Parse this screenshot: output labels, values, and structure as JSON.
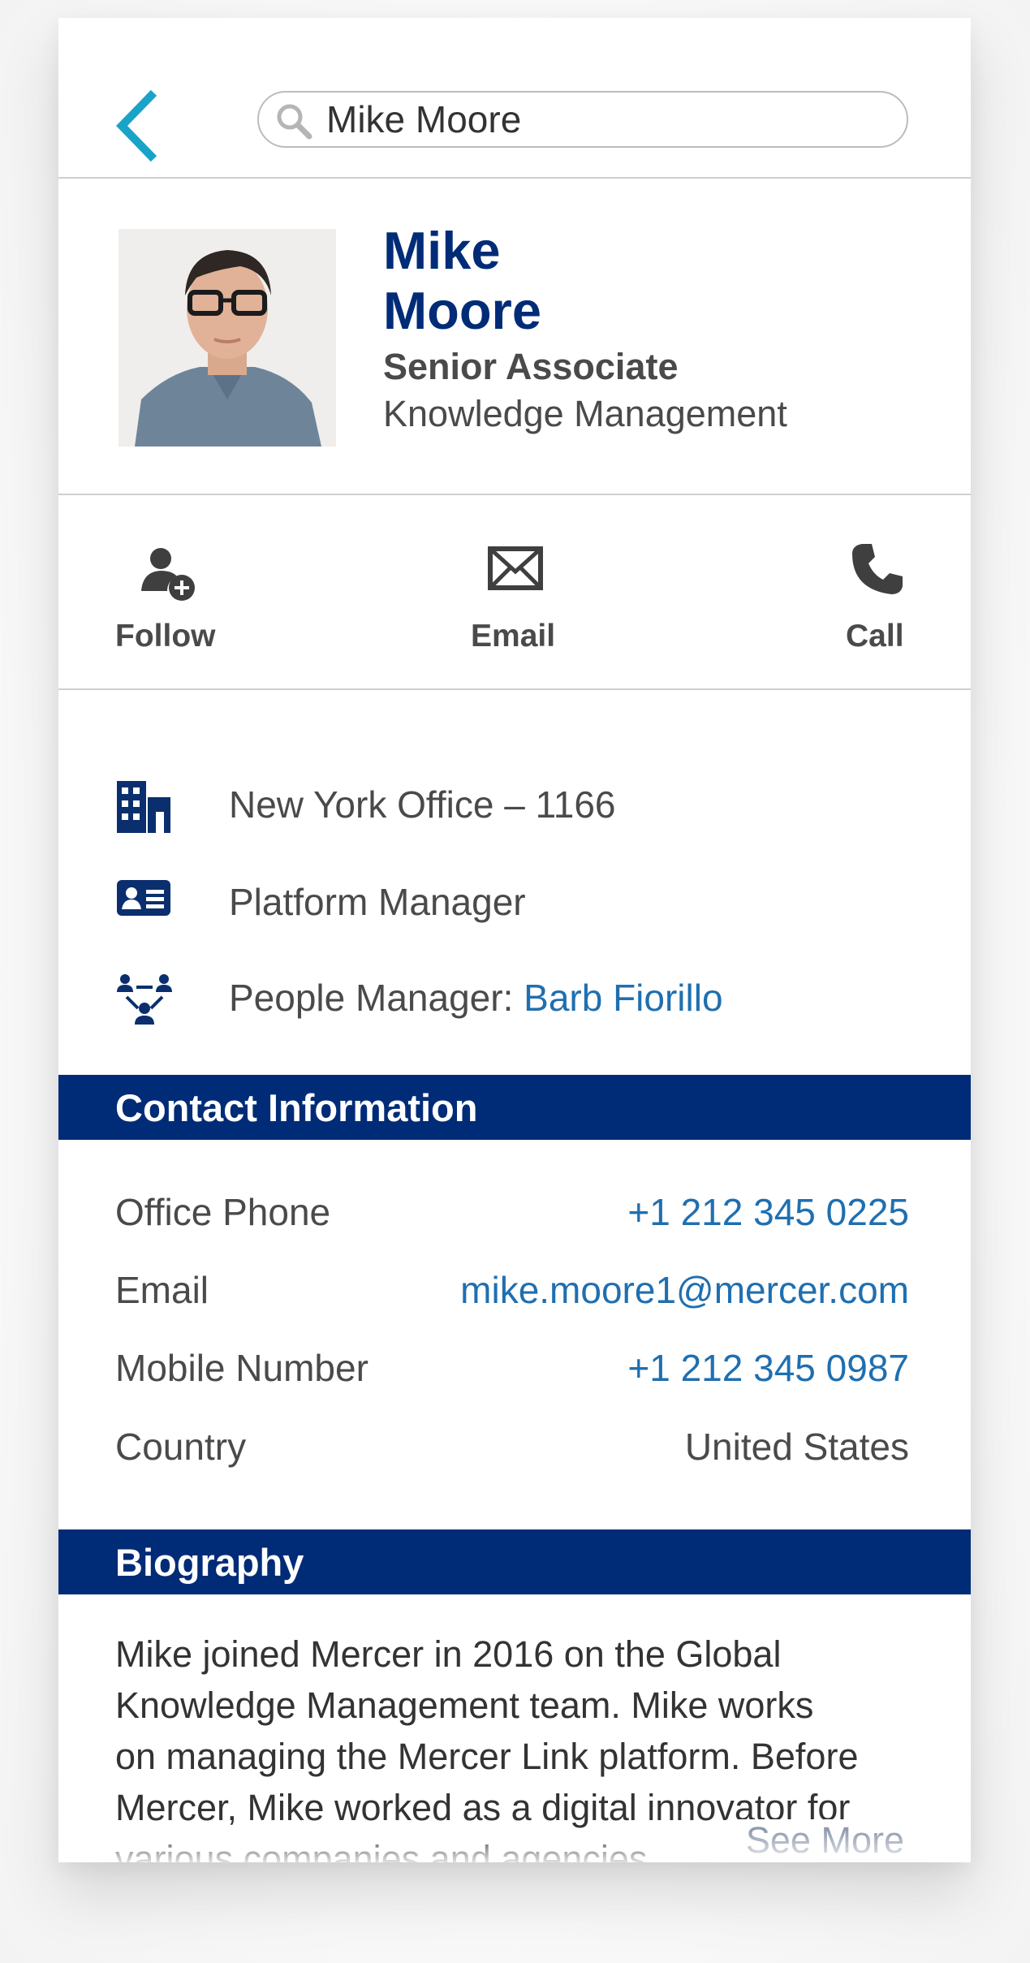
{
  "search": {
    "value": "Mike Moore"
  },
  "profile": {
    "first_name": "Mike",
    "last_name": "Moore",
    "title": "Senior Associate",
    "department": "Knowledge Management"
  },
  "actions": {
    "follow": "Follow",
    "email": "Email",
    "call": "Call"
  },
  "info": {
    "office": "New York Office – 1166",
    "role": "Platform Manager",
    "manager_label": "People Manager: ",
    "manager_name": "Barb Fiorillo"
  },
  "contact": {
    "heading": "Contact Information",
    "rows": [
      {
        "label": "Office Phone",
        "value": "+1 212 345 0225"
      },
      {
        "label": "Email",
        "value": "mike.moore1@mercer.com"
      },
      {
        "label": "Mobile Number",
        "value": "+1 212 345 0987"
      },
      {
        "label": "Country",
        "value": "United States"
      }
    ]
  },
  "biography": {
    "heading": "Biography",
    "lines": [
      "Mike joined Mercer in 2016 on the Global",
      "Knowledge Management team. Mike works",
      "on managing the Mercer Link platform. Before",
      "Mercer, Mike worked as a digital innovator for",
      "various companies and agencies."
    ],
    "see_more": "See More"
  },
  "colors": {
    "brand_navy": "#002c77",
    "link_blue": "#1f6fb0",
    "back_arrow_cyan": "#1aa3c8",
    "muted_link": "#8f9aae"
  },
  "icons": {
    "back": "chevron-left-icon",
    "search": "search-icon",
    "follow": "person-add-icon",
    "email": "envelope-icon",
    "call": "phone-icon",
    "office": "building-icon",
    "role": "id-card-icon",
    "manager": "org-chart-icon"
  }
}
